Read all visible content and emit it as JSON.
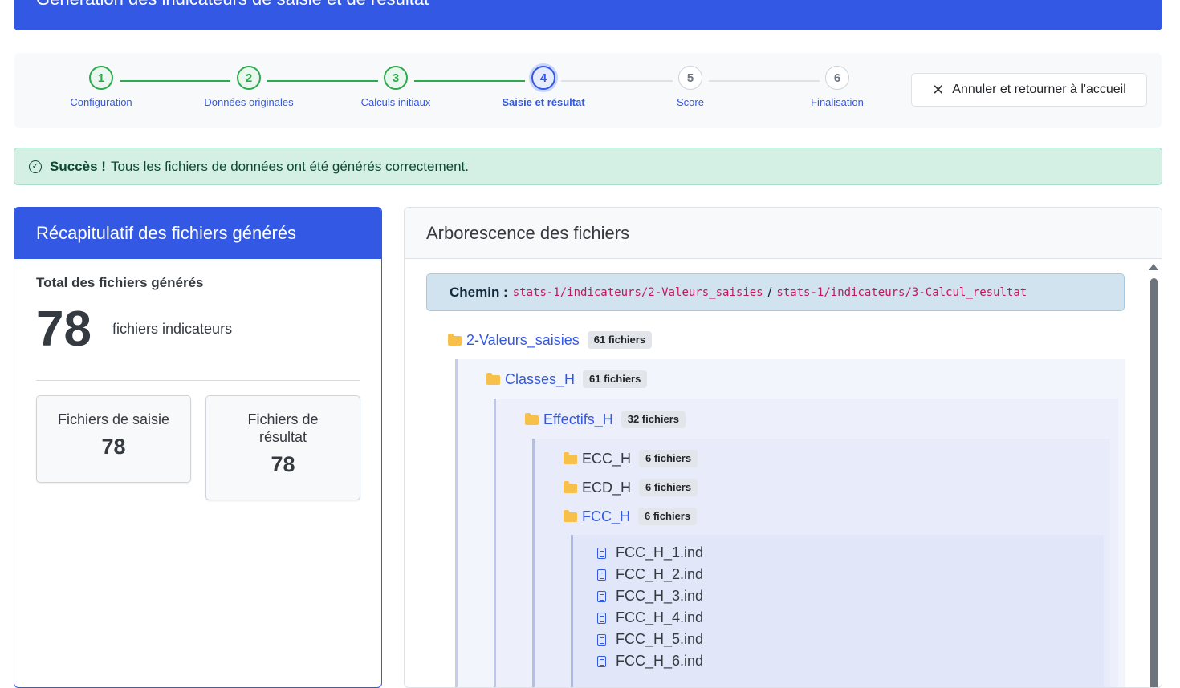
{
  "banner": {
    "title": "Génération des indicateurs de saisie et de résultat"
  },
  "stepper": {
    "steps": [
      {
        "number": "1",
        "label": "Configuration",
        "state": "done"
      },
      {
        "number": "2",
        "label": "Données originales",
        "state": "done"
      },
      {
        "number": "3",
        "label": "Calculs initiaux",
        "state": "done"
      },
      {
        "number": "4",
        "label": "Saisie et résultat",
        "state": "active"
      },
      {
        "number": "5",
        "label": "Score",
        "state": "todo"
      },
      {
        "number": "6",
        "label": "Finalisation",
        "state": "todo"
      }
    ],
    "cancel_label": "Annuler et retourner à l'accueil"
  },
  "alert": {
    "strong": "Succès !",
    "message": "Tous les fichiers de données ont été générés correctement."
  },
  "summary": {
    "title": "Récapitulatif des fichiers générés",
    "total_label": "Total des fichiers générés",
    "total_value": "78",
    "total_caption": "fichiers indicateurs",
    "cards": [
      {
        "label": "Fichiers de saisie",
        "value": "78"
      },
      {
        "label": "Fichiers de résultat",
        "value": "78"
      }
    ]
  },
  "tree": {
    "title": "Arborescence des fichiers",
    "path_label": "Chemin :",
    "path_1": "stats-1/indicateurs/2-Valeurs_saisies",
    "path_sep": "/",
    "path_2": "stats-1/indicateurs/3-Calcul_resultat",
    "root": {
      "name": "2-Valeurs_saisies",
      "badge": "61 fichiers"
    },
    "classes": {
      "name": "Classes_H",
      "badge": "61 fichiers"
    },
    "effectifs": {
      "name": "Effectifs_H",
      "badge": "32 fichiers"
    },
    "subfolders": [
      {
        "name": "ECC_H",
        "badge": "6 fichiers"
      },
      {
        "name": "ECD_H",
        "badge": "6 fichiers"
      },
      {
        "name": "FCC_H",
        "badge": "6 fichiers"
      }
    ],
    "files": [
      "FCC_H_1.ind",
      "FCC_H_2.ind",
      "FCC_H_3.ind",
      "FCC_H_4.ind",
      "FCC_H_5.ind",
      "FCC_H_6.ind"
    ]
  },
  "colors": {
    "primary": "#3358e4",
    "success": "#2fa84f",
    "folder": "#f7c04a"
  }
}
